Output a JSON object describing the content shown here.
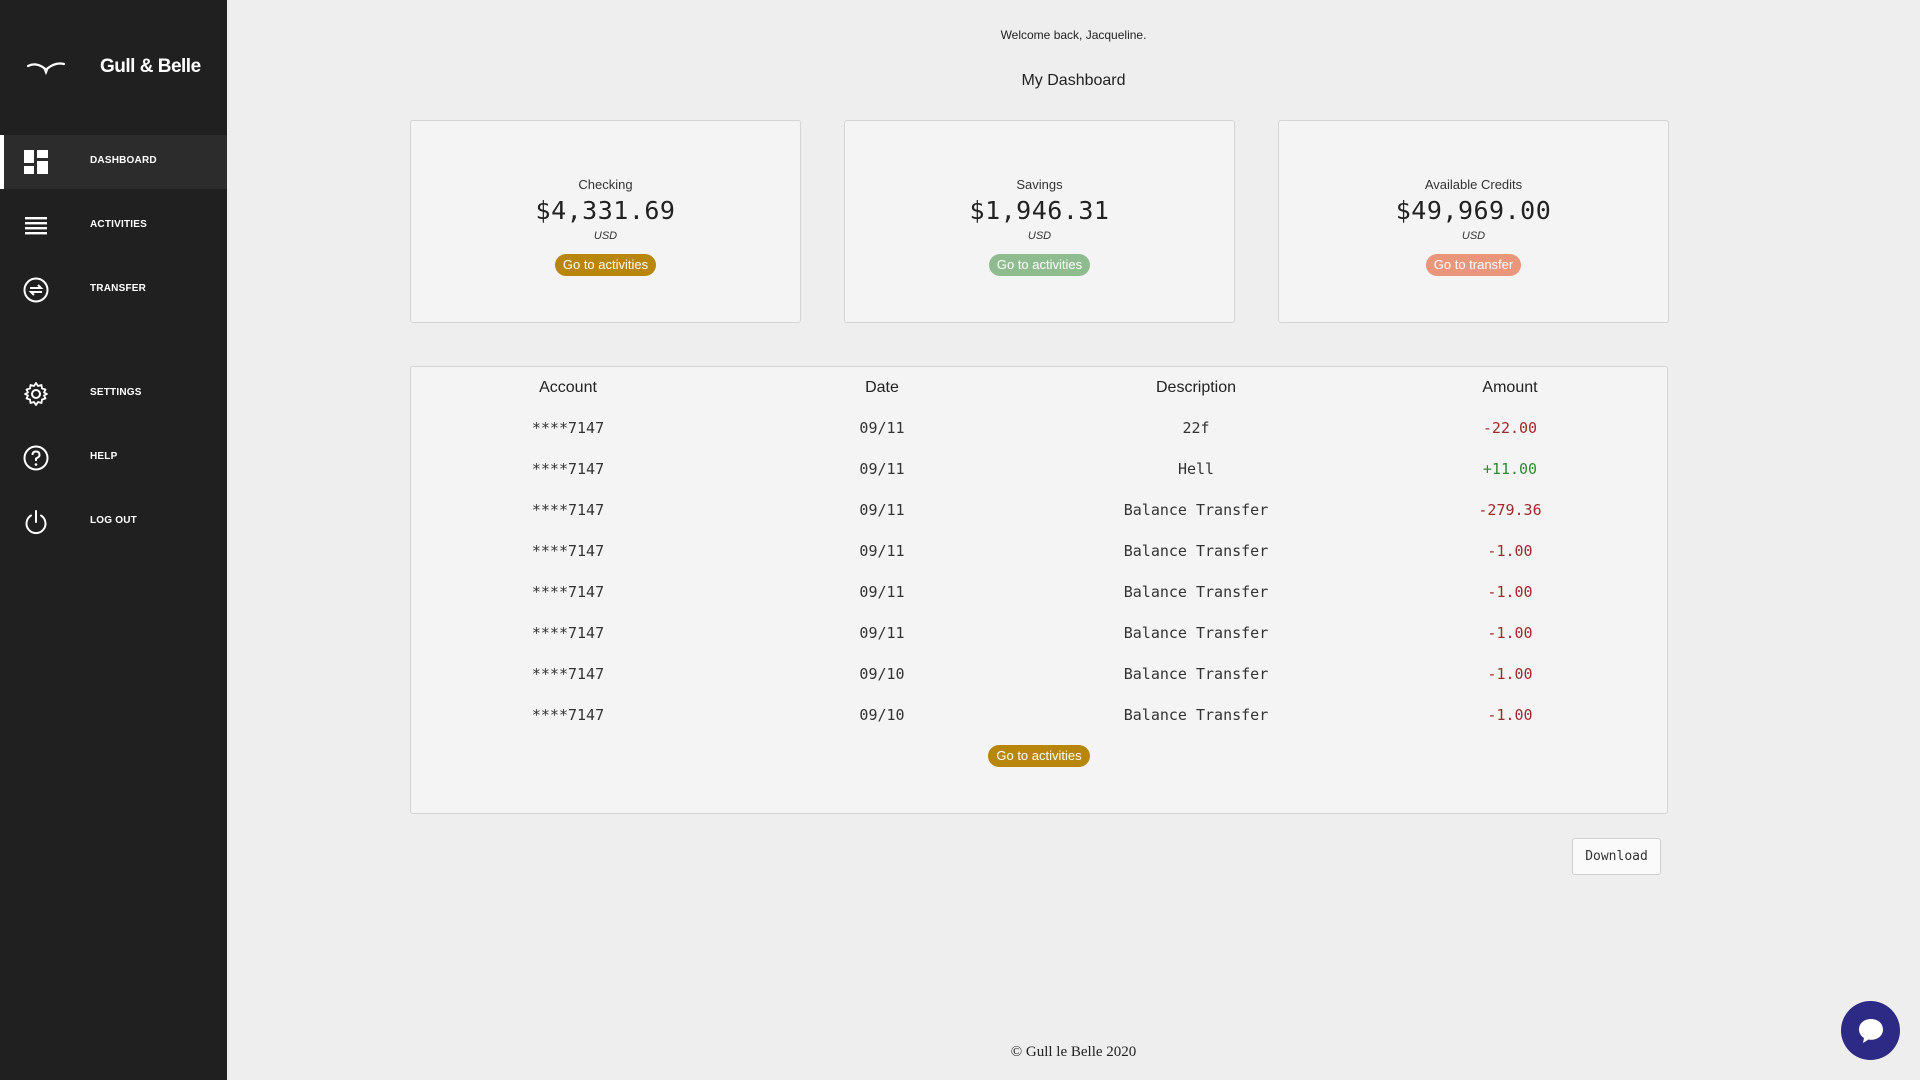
{
  "brand": {
    "name": "Gull & Belle"
  },
  "nav": {
    "items": [
      {
        "label": "DASHBOARD",
        "icon": "dashboard-icon"
      },
      {
        "label": "ACTIVITIES",
        "icon": "list-icon"
      },
      {
        "label": "TRANSFER",
        "icon": "transfer-icon"
      },
      {
        "label": "SETTINGS",
        "icon": "gear-icon"
      },
      {
        "label": "HELP",
        "icon": "help-icon"
      },
      {
        "label": "LOG OUT",
        "icon": "power-icon"
      }
    ]
  },
  "header": {
    "welcome": "Welcome back, Jacqueline.",
    "title": "My Dashboard"
  },
  "cards": [
    {
      "label": "Checking",
      "amount": "$4,331.69",
      "currency": "USD",
      "button": "Go to activities",
      "color": "#b8860b"
    },
    {
      "label": "Savings",
      "amount": "$1,946.31",
      "currency": "USD",
      "button": "Go to activities",
      "color": "#8fbc8f"
    },
    {
      "label": "Available Credits",
      "amount": "$49,969.00",
      "currency": "USD",
      "button": "Go to transfer",
      "color": "#e9967a"
    }
  ],
  "table": {
    "headers": [
      "Account",
      "Date",
      "Description",
      "Amount"
    ],
    "rows": [
      {
        "account": "****7147",
        "date": "09/11",
        "description": "22f",
        "amount": "-22.00"
      },
      {
        "account": "****7147",
        "date": "09/11",
        "description": "Hell",
        "amount": "+11.00"
      },
      {
        "account": "****7147",
        "date": "09/11",
        "description": "Balance Transfer",
        "amount": "-279.36"
      },
      {
        "account": "****7147",
        "date": "09/11",
        "description": "Balance Transfer",
        "amount": "-1.00"
      },
      {
        "account": "****7147",
        "date": "09/11",
        "description": "Balance Transfer",
        "amount": "-1.00"
      },
      {
        "account": "****7147",
        "date": "09/11",
        "description": "Balance Transfer",
        "amount": "-1.00"
      },
      {
        "account": "****7147",
        "date": "09/10",
        "description": "Balance Transfer",
        "amount": "-1.00"
      },
      {
        "account": "****7147",
        "date": "09/10",
        "description": "Balance Transfer",
        "amount": "-1.00"
      }
    ],
    "button": "Go to activities",
    "button_color": "#b8860b"
  },
  "download": {
    "label": "Download"
  },
  "footer": {
    "text": "© Gull le Belle 2020"
  },
  "chat": {
    "icon": "chat-bubble-icon",
    "color": "#2d2a85"
  }
}
